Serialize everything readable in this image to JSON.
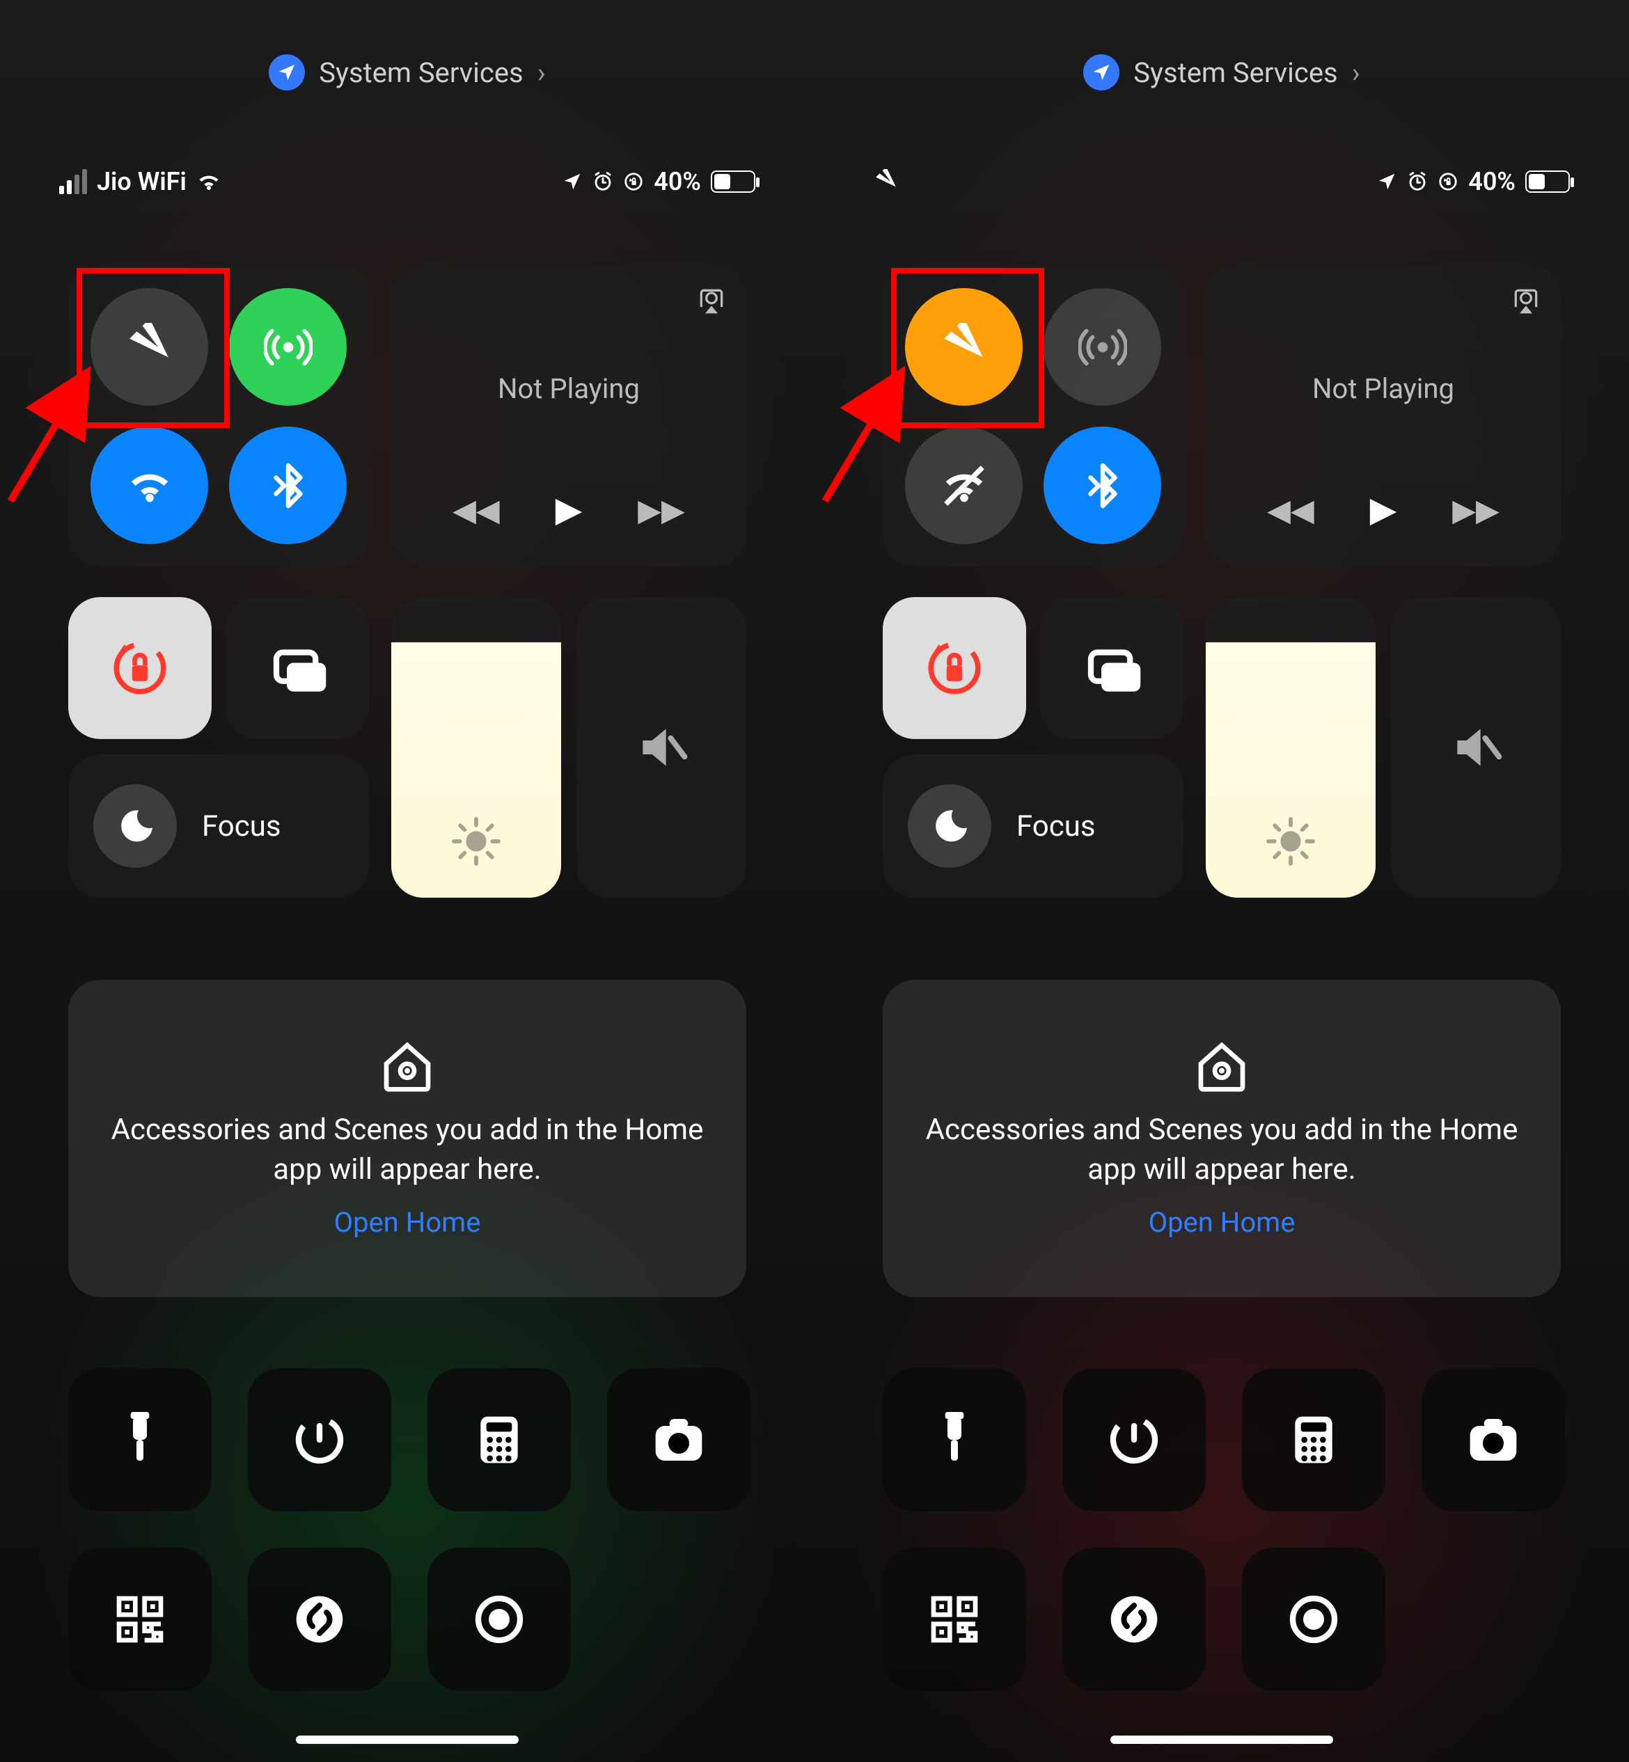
{
  "breadcrumb": {
    "label": "System Services"
  },
  "status": {
    "carrier": "Jio WiFi",
    "battery_percent": "40%"
  },
  "connectivity": {
    "airplane": "Airplane Mode",
    "cellular": "Cellular Data",
    "wifi": "Wi-Fi",
    "bluetooth": "Bluetooth"
  },
  "media": {
    "title": "Not Playing"
  },
  "controls": {
    "orientation_lock": "Orientation Lock",
    "screen_mirror": "Screen Mirroring",
    "focus": "Focus",
    "brightness": "Brightness",
    "volume_muted": "Volume Muted"
  },
  "home": {
    "message": "Accessories and Scenes you add in the Home app will appear here.",
    "link": "Open Home"
  },
  "tools": {
    "flashlight": "Flashlight",
    "timer": "Timer",
    "calculator": "Calculator",
    "camera": "Camera",
    "qr": "Code Scanner",
    "shazam": "Music Recognition",
    "record": "Screen Record"
  },
  "panels": [
    {
      "airplane_on": false,
      "show_carrier": true,
      "cellular_on": true,
      "wifi_on": true,
      "bt_on": true
    },
    {
      "airplane_on": true,
      "show_carrier": false,
      "cellular_on": false,
      "wifi_on": false,
      "bt_on": true
    }
  ],
  "colors": {
    "blue": "#0a84ff",
    "green": "#30d158",
    "orange": "#ff9f0a",
    "link": "#2e7eff",
    "highlight": "#ff0000"
  }
}
